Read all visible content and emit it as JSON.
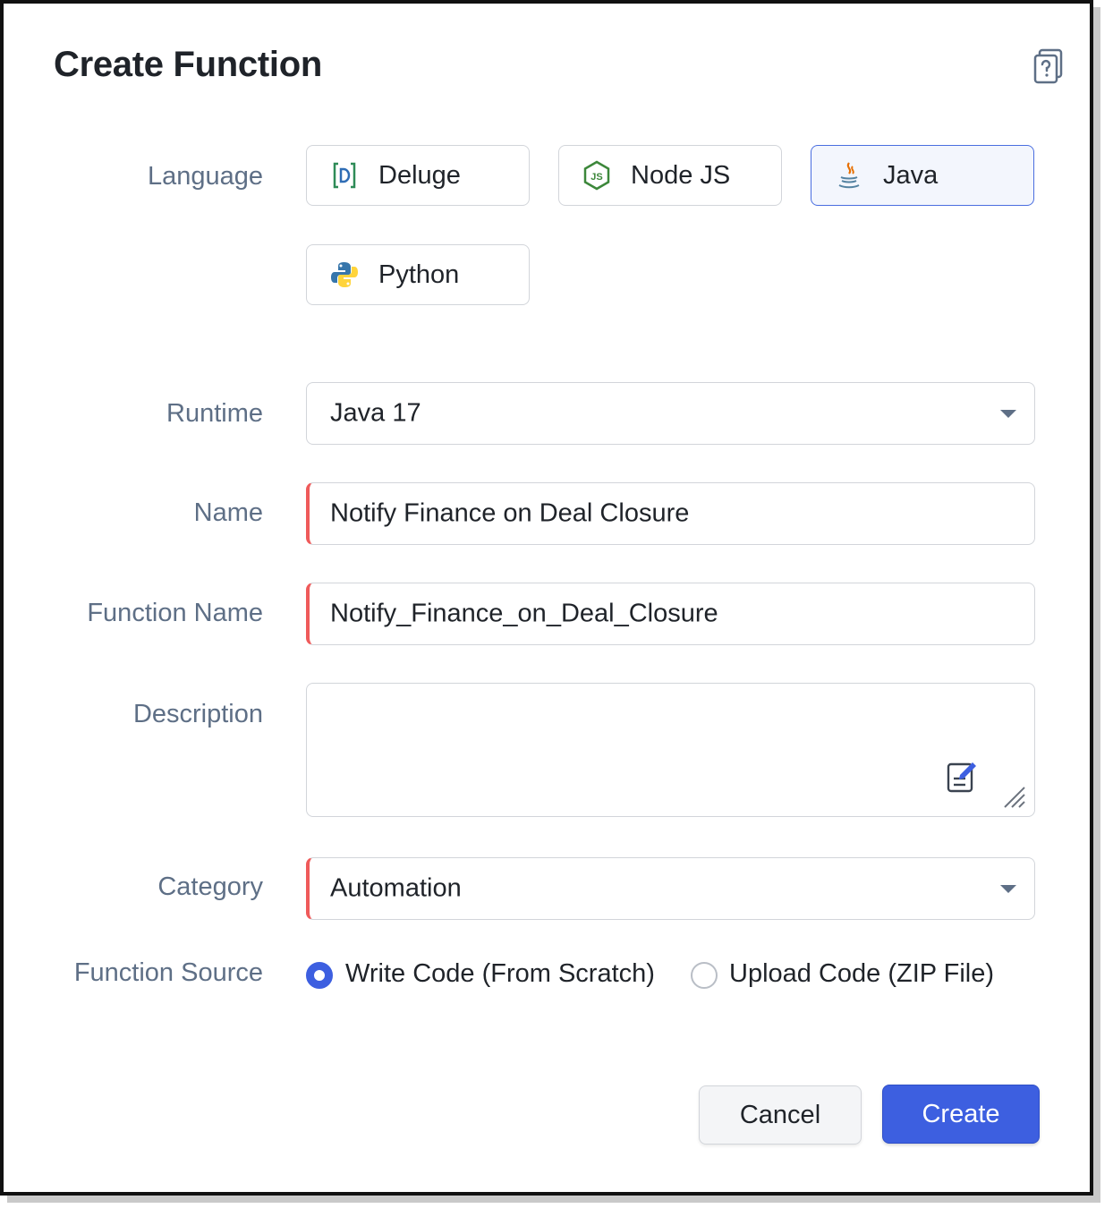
{
  "title": "Create Function",
  "labels": {
    "language": "Language",
    "runtime": "Runtime",
    "name": "Name",
    "function_name": "Function Name",
    "description": "Description",
    "category": "Category",
    "function_source": "Function Source"
  },
  "languages": [
    {
      "label": "Deluge",
      "icon": "deluge-icon",
      "selected": false
    },
    {
      "label": "Node JS",
      "icon": "nodejs-icon",
      "selected": false
    },
    {
      "label": "Java",
      "icon": "java-icon",
      "selected": true
    },
    {
      "label": "Python",
      "icon": "python-icon",
      "selected": false
    }
  ],
  "runtime": {
    "value": "Java 17"
  },
  "name": {
    "value": "Notify Finance on Deal Closure"
  },
  "function_name": {
    "value": "Notify_Finance_on_Deal_Closure"
  },
  "description": {
    "value": ""
  },
  "category": {
    "value": "Automation"
  },
  "function_source": {
    "options": [
      {
        "label": "Write Code (From Scratch)",
        "selected": true
      },
      {
        "label": "Upload Code (ZIP File)",
        "selected": false
      }
    ]
  },
  "buttons": {
    "cancel": "Cancel",
    "create": "Create"
  },
  "colors": {
    "accent": "#3d5fe0",
    "required": "#ef5a5a",
    "label": "#5e6f86"
  }
}
